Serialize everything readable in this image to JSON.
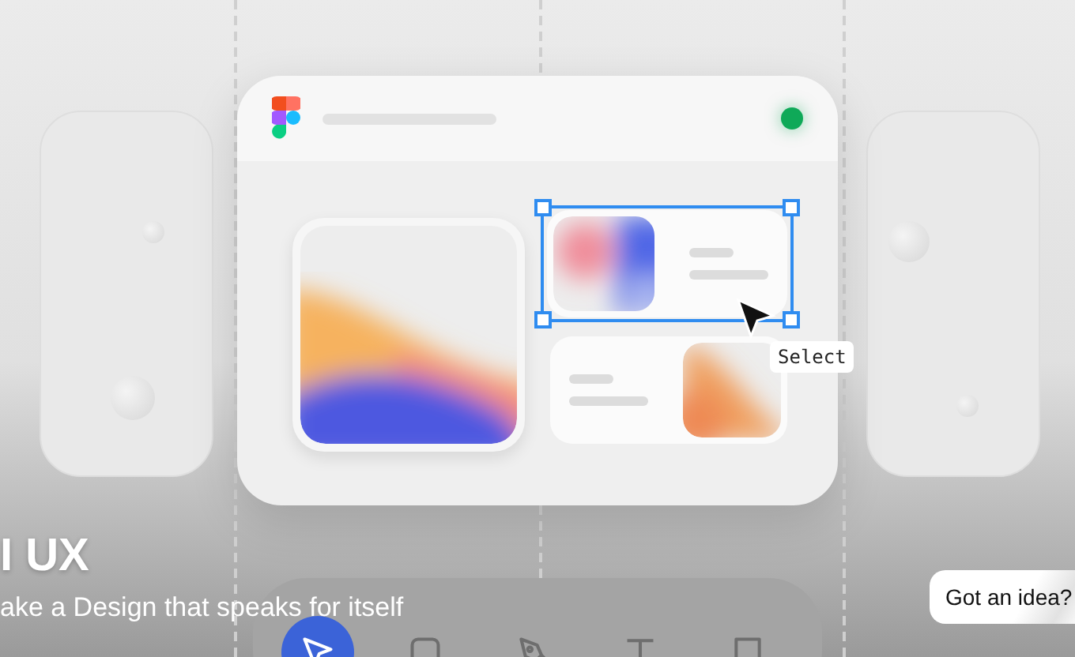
{
  "canvas": {
    "selection_tooltip": "Select"
  },
  "hero": {
    "heading": "I UX",
    "subtitle": "ake a Design that speaks for itself"
  },
  "toolbar": {
    "tools": [
      {
        "kind": "pointer",
        "selected": true
      },
      {
        "kind": "frame",
        "selected": false
      },
      {
        "kind": "pen",
        "selected": false
      },
      {
        "kind": "text",
        "selected": false
      },
      {
        "kind": "comment",
        "selected": false
      }
    ]
  },
  "idea_button": {
    "label": "Got an idea?"
  }
}
